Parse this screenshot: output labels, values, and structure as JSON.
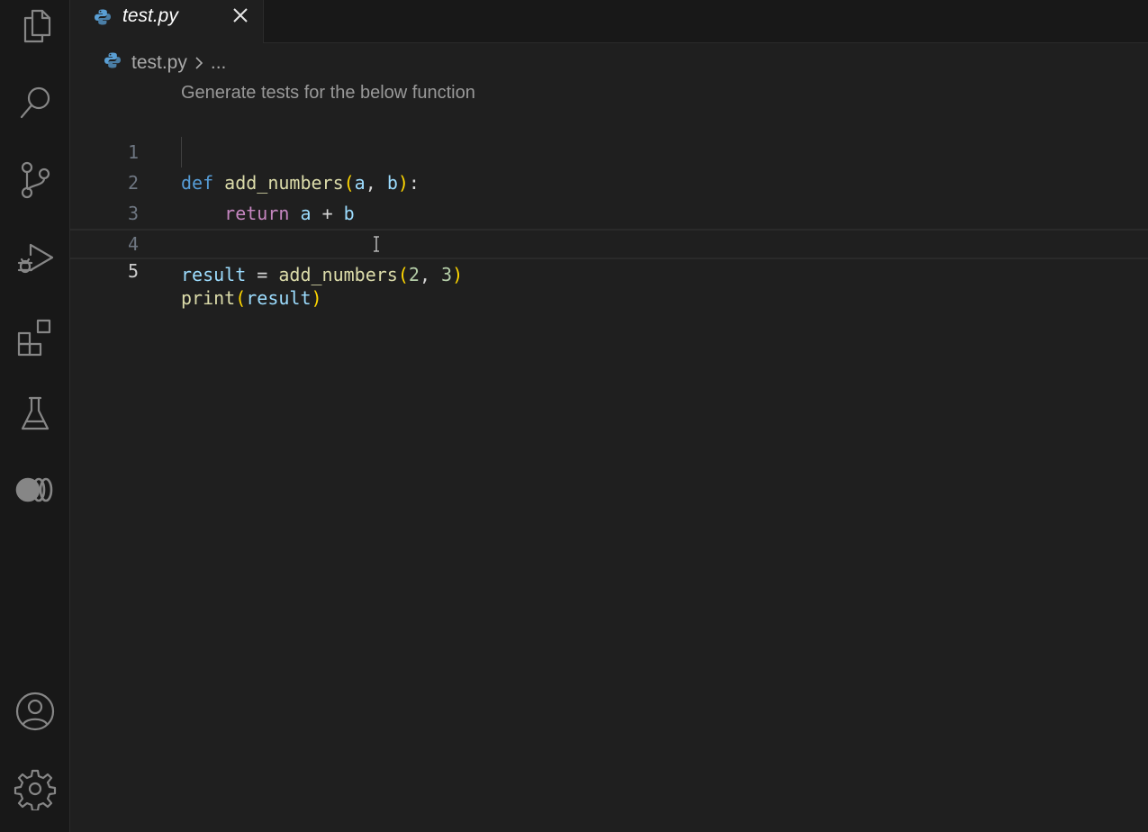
{
  "activity_bar": {
    "items": [
      {
        "icon": "explorer-icon"
      },
      {
        "icon": "search-icon"
      },
      {
        "icon": "source-control-icon"
      },
      {
        "icon": "run-debug-icon"
      },
      {
        "icon": "extensions-icon"
      },
      {
        "icon": "testing-icon"
      },
      {
        "icon": "remote-explorer-icon"
      }
    ],
    "bottom_items": [
      {
        "icon": "account-icon"
      },
      {
        "icon": "settings-gear-icon"
      }
    ]
  },
  "tab": {
    "label": "test.py",
    "icon": "python-icon"
  },
  "breadcrumb": {
    "file": "test.py",
    "separator_icon": "chevron-right-icon",
    "more": "..."
  },
  "editor": {
    "codelens": "Generate tests for the below function",
    "lines": [
      {
        "number": "1"
      },
      {
        "number": "2"
      },
      {
        "number": "3"
      },
      {
        "number": "4"
      },
      {
        "number": "5"
      }
    ],
    "tokens": {
      "l1_def": "def",
      "l1_fn": "add_numbers",
      "l1_open": "(",
      "l1_a": "a",
      "l1_comma": ",",
      "l1_b": "b",
      "l1_close": ")",
      "l1_colon": ":",
      "l2_return": "return",
      "l2_a": "a",
      "l2_plus": "+",
      "l2_b": "b",
      "l4_result": "result",
      "l4_eq": "=",
      "l4_fn": "add_numbers",
      "l4_open": "(",
      "l4_2": "2",
      "l4_comma": ",",
      "l4_3": "3",
      "l4_close": ")",
      "l5_fn": "print",
      "l5_open": "(",
      "l5_arg": "result",
      "l5_close": ")"
    },
    "current_line": "5"
  },
  "colors": {
    "background": "#1f1f1f",
    "activity_bar": "#181818",
    "keyword": "#569cd6",
    "control": "#c586c0",
    "function": "#dcdcaa",
    "variable": "#9cdcfe",
    "number": "#b5cea8",
    "bracket": "#ffd700"
  }
}
